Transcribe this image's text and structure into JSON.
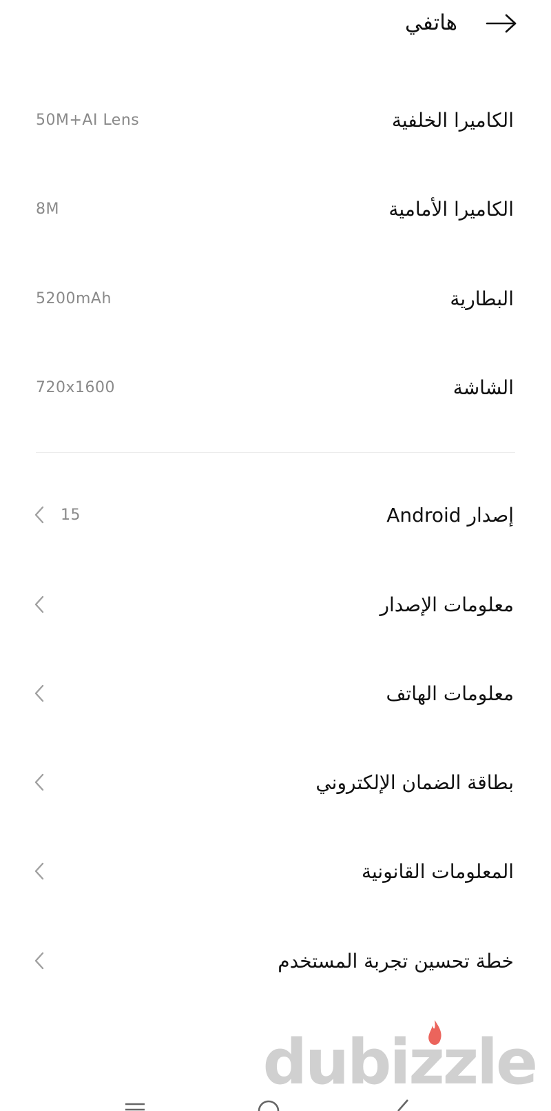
{
  "header": {
    "title": "هاتفي",
    "back_icon": "arrow-right-icon"
  },
  "specs": [
    {
      "label": "الكاميرا الخلفية",
      "value": "50M+AI Lens"
    },
    {
      "label": "الكاميرا الأمامية",
      "value": "8M"
    },
    {
      "label": "البطارية",
      "value": "5200mAh"
    },
    {
      "label": "الشاشة",
      "value": "720x1600"
    }
  ],
  "menu": [
    {
      "label": "إصدار Android",
      "value": "15",
      "icon": "chevron-left-icon"
    },
    {
      "label": "معلومات الإصدار",
      "value": "",
      "icon": "chevron-left-icon"
    },
    {
      "label": "معلومات الهاتف",
      "value": "",
      "icon": "chevron-left-icon"
    },
    {
      "label": "بطاقة الضمان الإلكتروني",
      "value": "",
      "icon": "chevron-left-icon"
    },
    {
      "label": "المعلومات القانونية",
      "value": "",
      "icon": "chevron-left-icon"
    },
    {
      "label": "خطة تحسين تجربة المستخدم",
      "value": "",
      "icon": "chevron-left-icon"
    }
  ],
  "watermark": {
    "text": "dubizzle",
    "accent_color": "#e8493f"
  },
  "colors": {
    "text_primary": "#111111",
    "text_secondary": "#8a8a8a",
    "chevron": "#a0a0a0",
    "divider": "#ececec"
  }
}
